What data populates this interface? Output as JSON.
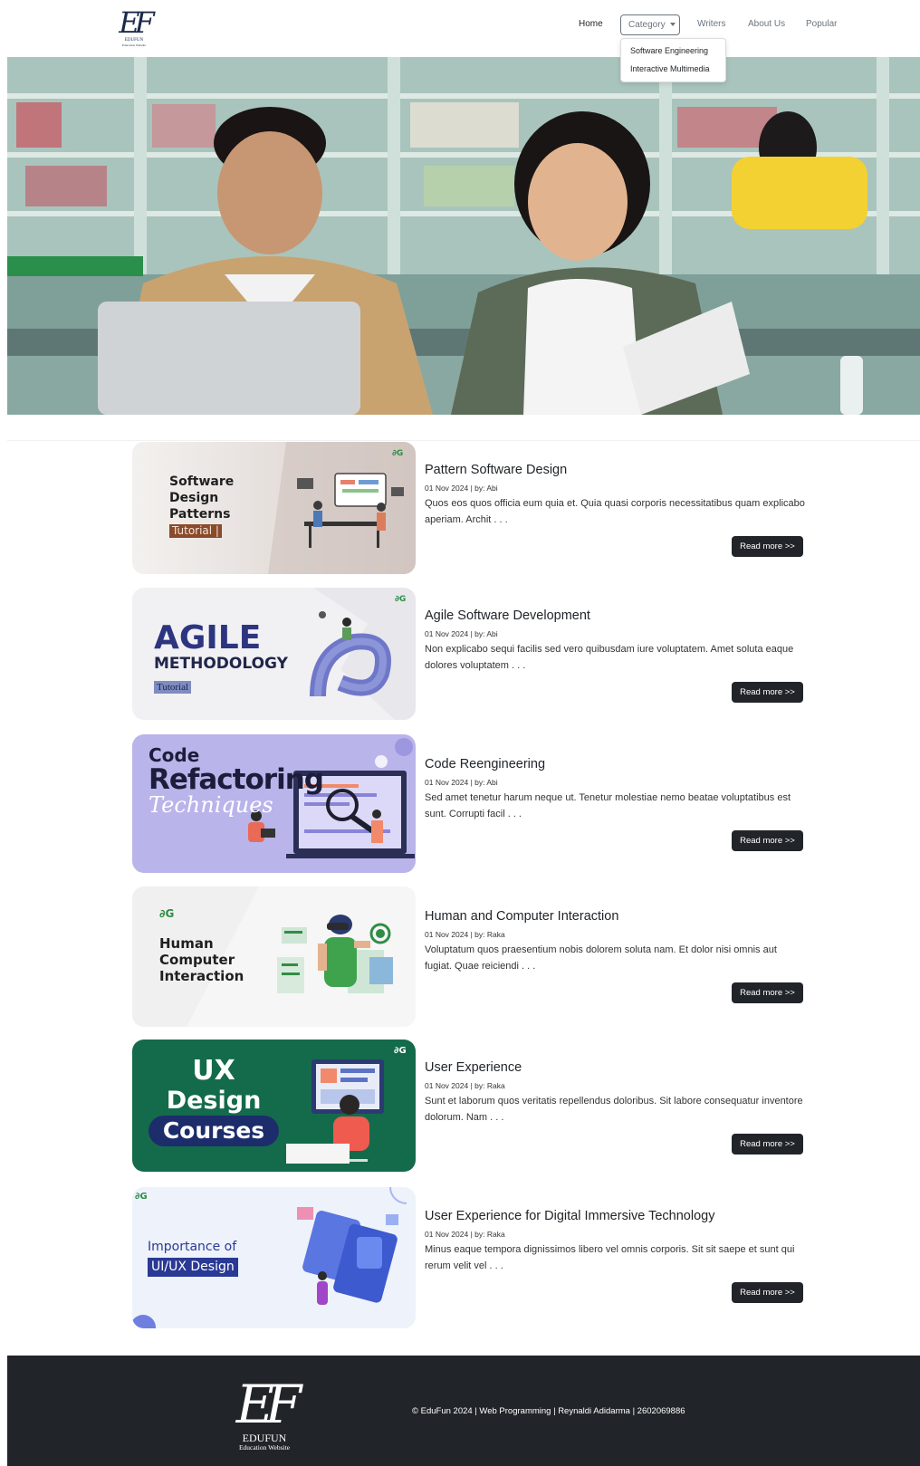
{
  "navbar": {
    "logo": {
      "mark": "EF",
      "brand": "EDUFUN",
      "tagline": "Education Website"
    },
    "links": {
      "home": "Home",
      "category": "Category",
      "writers": "Writers",
      "about": "About Us",
      "popular": "Popular"
    },
    "dropdown": [
      "Software Engineering",
      "Interactive Multimedia"
    ]
  },
  "hero": {
    "alt": "Students studying in a library"
  },
  "articles": [
    {
      "title": "Pattern Software Design",
      "meta": "01 Nov 2024 | by: Abi",
      "excerpt": "Quos eos quos officia eum quia et. Quia quasi corporis necessitatibus quam explicabo aperiam. Archit . . .",
      "button": "Read more >>",
      "thumb": {
        "line1": "Software",
        "line2": "Design",
        "line3": "Patterns",
        "badge": "Tutorial |"
      }
    },
    {
      "title": "Agile Software Development",
      "meta": "01 Nov 2024 | by: Abi",
      "excerpt": "Non explicabo sequi facilis sed vero quibusdam iure voluptatem. Amet soluta eaque dolores voluptatem . . .",
      "button": "Read more >>",
      "thumb": {
        "line1": "AGILE",
        "line2": "METHODOLOGY",
        "badge": "Tutorial"
      }
    },
    {
      "title": "Code Reengineering",
      "meta": "01 Nov 2024 | by: Abi",
      "excerpt": "Sed amet tenetur harum neque ut. Tenetur molestiae nemo beatae voluptatibus est sunt. Corrupti facil . . .",
      "button": "Read more >>",
      "thumb": {
        "line1": "Code",
        "line2": "Refactoring",
        "line3": "Techniques"
      }
    },
    {
      "title": "Human and Computer Interaction",
      "meta": "01 Nov 2024 | by: Raka",
      "excerpt": "Voluptatum quos praesentium nobis dolorem soluta nam. Et dolor nisi omnis aut fugiat. Quae reiciendi . . .",
      "button": "Read more >>",
      "thumb": {
        "line1": "Human",
        "line2": "Computer",
        "line3": "Interaction"
      }
    },
    {
      "title": "User Experience",
      "meta": "01 Nov 2024 | by: Raka",
      "excerpt": "Sunt et laborum quos veritatis repellendus doloribus. Sit labore consequatur inventore dolorum. Nam . . .",
      "button": "Read more >>",
      "thumb": {
        "line1": "UX",
        "line2": "Design",
        "line3": "Courses"
      }
    },
    {
      "title": "User Experience for Digital Immersive Technology",
      "meta": "01 Nov 2024 | by: Raka",
      "excerpt": "Minus eaque tempora dignissimos libero vel omnis corporis. Sit sit saepe et sunt qui rerum velit vel . . .",
      "button": "Read more >>",
      "thumb": {
        "line1": "Importance of",
        "line2": "UI/UX Design"
      }
    }
  ],
  "footer": {
    "logo": {
      "mark": "EF",
      "brand": "EDUFUN",
      "tagline": "Education Website"
    },
    "copyright": "© EduFun 2024 | Web Programming | Reynaldi Adidarma | 2602069886"
  },
  "colors": {
    "navy": "#1c2a4a",
    "dark": "#212529",
    "muted": "#6c757d",
    "ux_green": "#146b4b",
    "refactor_purple": "#b9b4ea"
  }
}
